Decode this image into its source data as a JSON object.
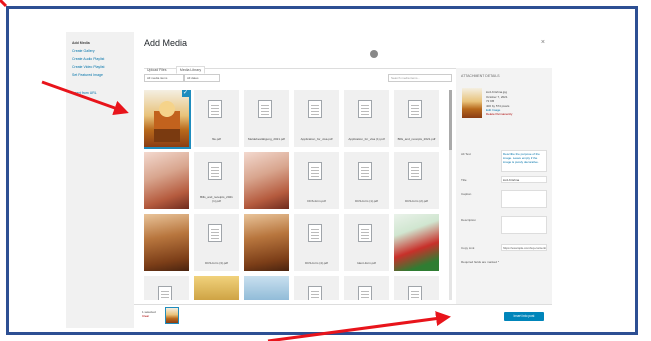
{
  "left_menu": {
    "items": [
      {
        "label": "Add Media",
        "key": "add-media"
      },
      {
        "label": "Create Gallery",
        "key": "create-gallery"
      },
      {
        "label": "Create Audio Playlist",
        "key": "create-audio-playlist"
      },
      {
        "label": "Create Video Playlist",
        "key": "create-video-playlist"
      },
      {
        "label": "Set Featured Image",
        "key": "set-featured-image"
      },
      {
        "label": "Insert from URL",
        "key": "insert-from-url"
      }
    ]
  },
  "modal": {
    "title": "Add Media",
    "close": "×",
    "tabs": [
      "Upload Files",
      "Media Library"
    ],
    "filter_type": "All media items",
    "filter_date": "All dates",
    "search_placeholder": "Search media items..."
  },
  "grid": {
    "tiles": [
      {
        "kind": "photo",
        "style": "deity",
        "caption": "",
        "selected": true
      },
      {
        "kind": "doc",
        "caption": "file.pdf"
      },
      {
        "kind": "doc",
        "caption": "Meldebestätigung_2021.pdf"
      },
      {
        "kind": "doc",
        "caption": "Application_for_visa.pdf"
      },
      {
        "kind": "doc",
        "caption": "Application_for_visa (1).pdf"
      },
      {
        "kind": "doc",
        "caption": "Bills_and_receipts_2021.pdf"
      },
      {
        "kind": "photo",
        "style": "woman",
        "caption": ""
      },
      {
        "kind": "doc",
        "caption": "Bills_and_receipts_2021 (1).pdf"
      },
      {
        "kind": "photo",
        "style": "woman",
        "caption": ""
      },
      {
        "kind": "doc",
        "caption": "DCS-form.pdf"
      },
      {
        "kind": "doc",
        "caption": "DCS-form (1).pdf"
      },
      {
        "kind": "doc",
        "caption": "DCS-form (2).pdf"
      },
      {
        "kind": "photo",
        "style": "brown",
        "caption": ""
      },
      {
        "kind": "doc",
        "caption": "DCS-form (3).pdf"
      },
      {
        "kind": "photo",
        "style": "brown",
        "caption": ""
      },
      {
        "kind": "doc",
        "caption": "DCS-form (4).pdf"
      },
      {
        "kind": "doc",
        "caption": "Ident-form.pdf"
      },
      {
        "kind": "photo",
        "style": "chili",
        "caption": ""
      },
      {
        "kind": "doc",
        "caption": ""
      },
      {
        "kind": "photo",
        "style": "gold",
        "caption": ""
      },
      {
        "kind": "photo",
        "style": "sky",
        "caption": ""
      },
      {
        "kind": "doc",
        "caption": ""
      },
      {
        "kind": "doc",
        "caption": ""
      },
      {
        "kind": "doc",
        "caption": ""
      }
    ]
  },
  "details": {
    "title": "Attachment Details",
    "filename": "lord-Krishna.jpg",
    "date": "October 7, 2021",
    "size": "72 KB",
    "dimensions": "400 by 574 pixels",
    "edit_link": "Edit Image",
    "delete_link": "Delete Permanently",
    "fields": [
      {
        "label": "Alt Text",
        "value": "",
        "height": 12
      },
      {
        "label": "Title",
        "value": "lord-Krishna",
        "height": 7
      },
      {
        "label": "Caption",
        "value": "",
        "height": 14
      },
      {
        "label": "Description",
        "value": "",
        "height": 14
      }
    ],
    "alt_help": "Describe the purpose of the image. Leave empty if the image is purely decorative.",
    "copy_link_label": "Copy Link",
    "copy_link_value": "https://example.com/wp-content/...",
    "required_note": "Required fields are marked *"
  },
  "footer": {
    "selected_count": "1 selected",
    "clear_label": "Clear",
    "insert_button": "Insert into post"
  },
  "colors": {
    "frame_border": "#2d4f93",
    "arrow": "#e8141b",
    "wp_blue": "#0085ba",
    "selection": "#1e8cbe"
  }
}
